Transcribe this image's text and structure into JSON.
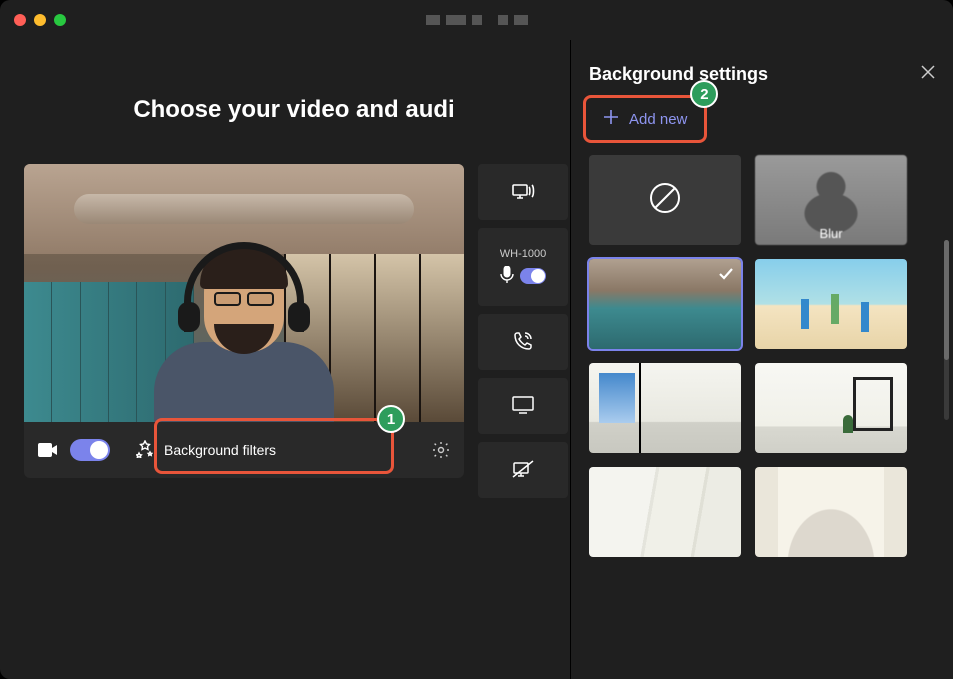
{
  "titlebar": {
    "close": "close",
    "minimize": "minimize",
    "maximize": "maximize"
  },
  "heading": "Choose your video and audi",
  "preview_bar": {
    "camera_on": true,
    "bg_filters_label": "Background filters"
  },
  "controls": {
    "audio_device": "WH-1000",
    "mic_on": true
  },
  "callouts": {
    "c1": "1",
    "c2": "2"
  },
  "right_panel": {
    "title": "Background settings",
    "add_new": "Add new",
    "blur_label": "Blur"
  },
  "background_options": [
    {
      "id": "none",
      "kind": "none"
    },
    {
      "id": "blur",
      "kind": "blur"
    },
    {
      "id": "office",
      "kind": "office",
      "selected": true
    },
    {
      "id": "beach",
      "kind": "beach"
    },
    {
      "id": "room1",
      "kind": "room1"
    },
    {
      "id": "room2",
      "kind": "room2"
    },
    {
      "id": "white1",
      "kind": "white1"
    },
    {
      "id": "white2",
      "kind": "white2"
    }
  ]
}
